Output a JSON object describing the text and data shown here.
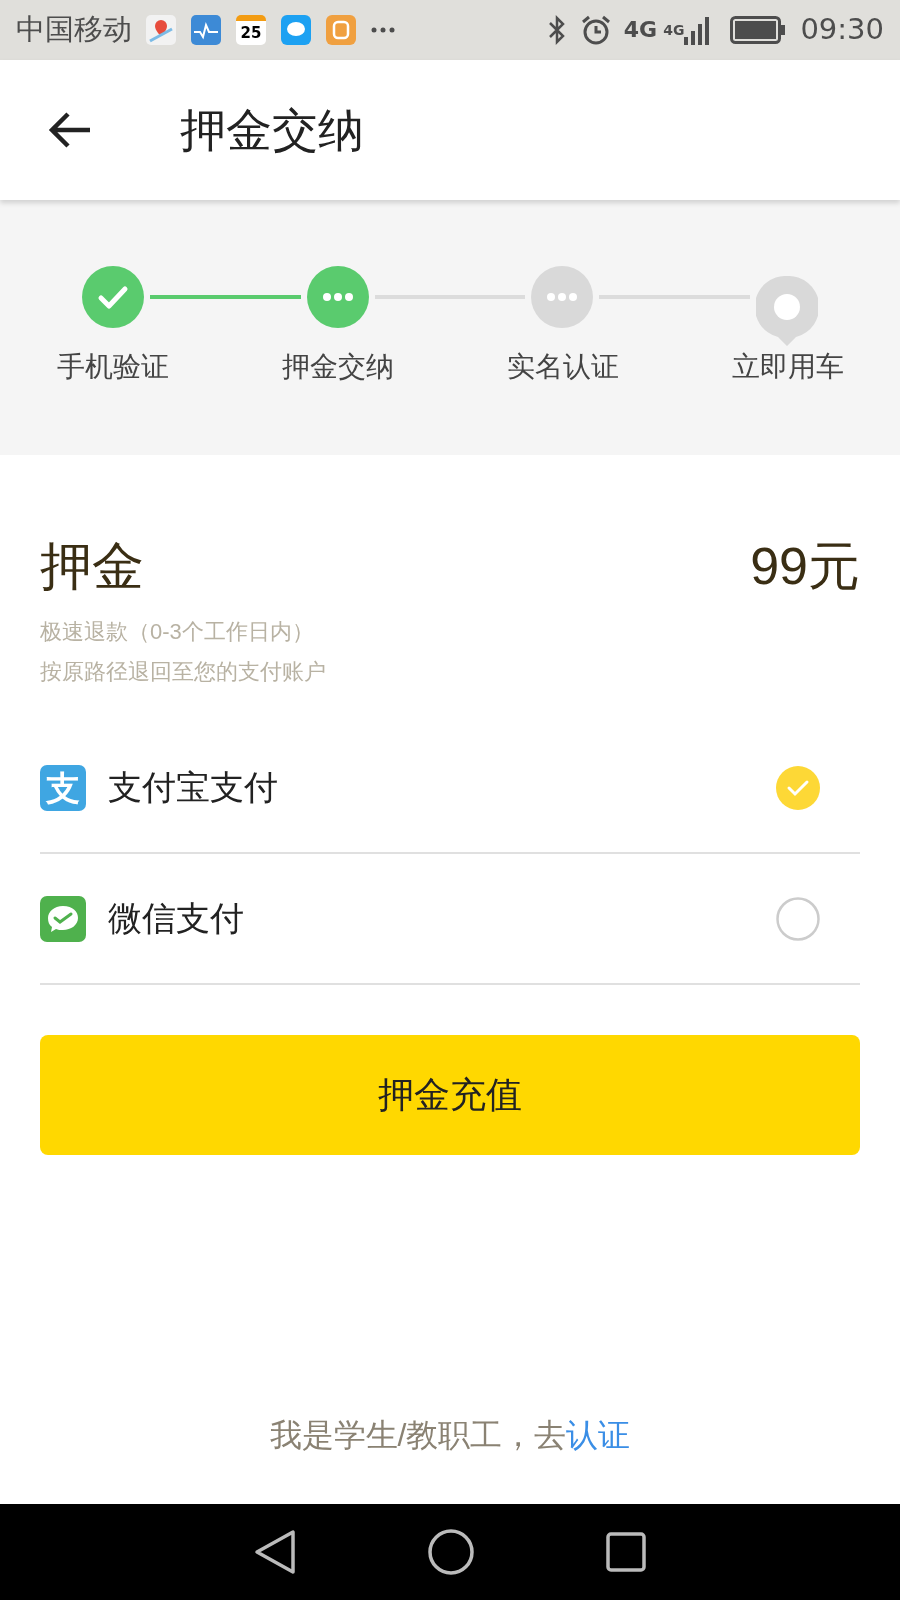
{
  "status_bar": {
    "carrier": "中国移动",
    "calendar_day": "25",
    "network_1": "4G",
    "network_2": "4G",
    "time": "09:30"
  },
  "app_bar": {
    "title": "押金交纳"
  },
  "steps": [
    {
      "label": "手机验证",
      "kind": "done"
    },
    {
      "label": "押金交纳",
      "kind": "current"
    },
    {
      "label": "实名认证",
      "kind": "pending"
    },
    {
      "label": "立即用车",
      "kind": "final"
    }
  ],
  "deposit": {
    "label": "押金",
    "amount": "99元",
    "notes": [
      "极速退款（0-3个工作日内）",
      "按原路径退回至您的支付账户"
    ]
  },
  "payment_methods": [
    {
      "label": "支付宝支付",
      "kind": "alipay",
      "icon_text": "支",
      "selected": true
    },
    {
      "label": "微信支付",
      "kind": "wechat",
      "selected": false
    }
  ],
  "submit_button": "押金充值",
  "footer": {
    "text": "我是学生/教职工，去",
    "link": "认证"
  }
}
